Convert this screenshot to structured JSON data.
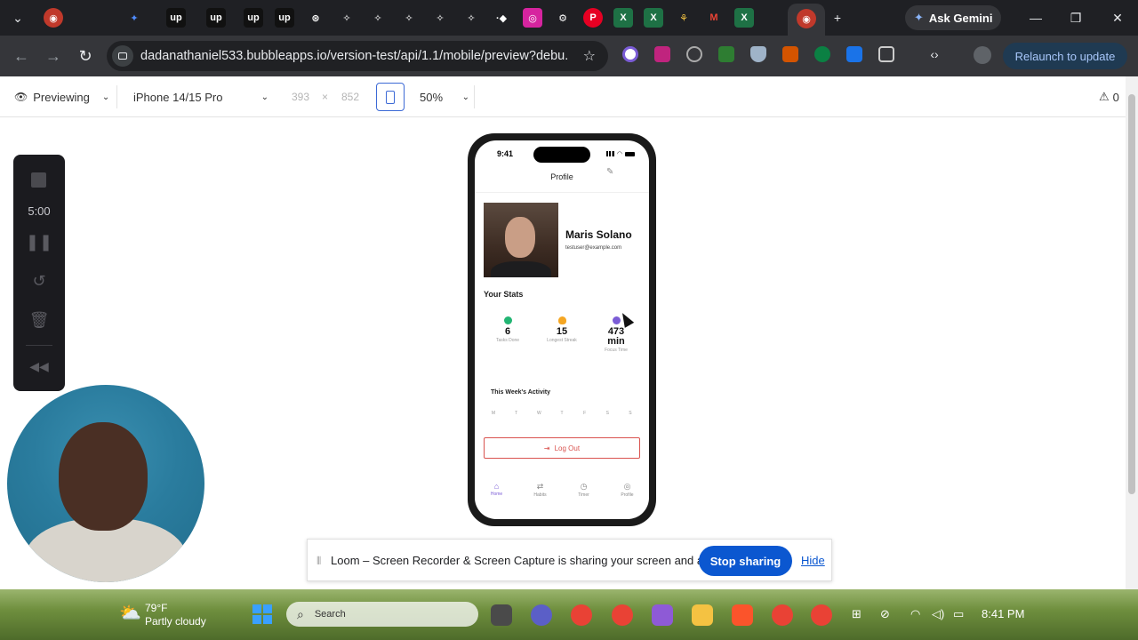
{
  "browser": {
    "ask_gemini": "Ask Gemini",
    "url": "dadanathaniel533.bubbleapps.io/version-test/api/1.1/mobile/preview?debu...",
    "relaunch": "Relaunch to update"
  },
  "preview_toolbar": {
    "mode": "Previewing",
    "device": "iPhone 14/15 Pro",
    "width": "393",
    "times": "×",
    "height": "852",
    "zoom": "50%",
    "warnings": "0"
  },
  "loom": {
    "timer": "5:00"
  },
  "phone": {
    "status_time": "9:41",
    "header_title": "Profile",
    "user_name": "Maris Solano",
    "user_email": "testuser@example.com",
    "stats_title": "Your Stats",
    "stats": [
      {
        "value": "6",
        "label": "Tasks Done",
        "color": "#22b573"
      },
      {
        "value": "15",
        "label": "Longest Streak",
        "color": "#f5a623"
      },
      {
        "value": "473 min",
        "label": "Focus Time",
        "color": "#7b5cd6"
      }
    ],
    "week_title": "This Week's Activity",
    "week_days": [
      "M",
      "T",
      "W",
      "T",
      "F",
      "S",
      "S"
    ],
    "logout": "Log Out",
    "nav": [
      {
        "label": "Home",
        "icon": "home-icon"
      },
      {
        "label": "Habits",
        "icon": "repeat-icon"
      },
      {
        "label": "Timer",
        "icon": "timer-icon"
      },
      {
        "label": "Profile",
        "icon": "profile-icon"
      }
    ]
  },
  "share_bar": {
    "message": "Loom – Screen Recorder & Screen Capture is sharing your screen and audio.",
    "stop": "Stop sharing",
    "hide": "Hide"
  },
  "taskbar": {
    "temp": "79°F",
    "condition": "Partly cloudy",
    "search": "Search",
    "time": "8:41 PM"
  },
  "colors": {
    "accent": "#0b57d0",
    "purple": "#7b5cd6",
    "danger": "#d9534f"
  }
}
